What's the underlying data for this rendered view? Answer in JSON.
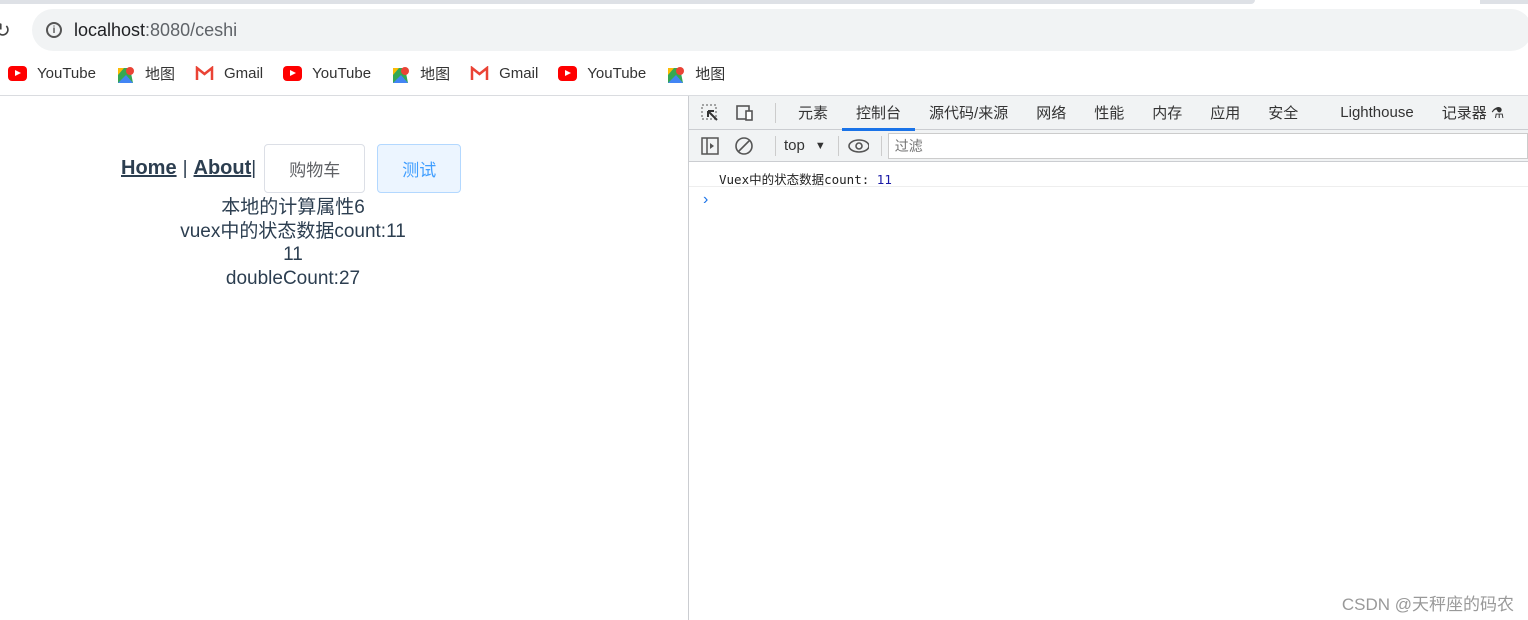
{
  "browser": {
    "url_host": "localhost",
    "url_rest": ":8080/ceshi",
    "bookmarks": [
      {
        "label": "YouTube",
        "icon": "youtube-icon"
      },
      {
        "label": "地图",
        "icon": "maps-icon"
      },
      {
        "label": "Gmail",
        "icon": "gmail-icon"
      },
      {
        "label": "YouTube",
        "icon": "youtube-icon"
      },
      {
        "label": "地图",
        "icon": "maps-icon"
      },
      {
        "label": "Gmail",
        "icon": "gmail-icon"
      },
      {
        "label": "YouTube",
        "icon": "youtube-icon"
      },
      {
        "label": "地图",
        "icon": "maps-icon"
      }
    ]
  },
  "page": {
    "nav": {
      "home": "Home",
      "sep": "|",
      "about": "About",
      "sep2": "|"
    },
    "buttons": {
      "cart": "购物车",
      "test": "测试"
    },
    "lines": [
      "本地的计算属性6",
      "vuex中的状态数据count:11",
      "11",
      "doubleCount:27"
    ]
  },
  "devtools": {
    "tabs": [
      "元素",
      "控制台",
      "源代码/来源",
      "网络",
      "性能",
      "内存",
      "应用",
      "安全",
      "Lighthouse",
      "记录器"
    ],
    "active_tab": "控制台",
    "context": "top",
    "filter_placeholder": "过滤",
    "log": {
      "text": "Vuex中的状态数据count:",
      "value": "11"
    },
    "accent": "#1a73e8"
  },
  "watermark": "CSDN @天秤座的码农"
}
